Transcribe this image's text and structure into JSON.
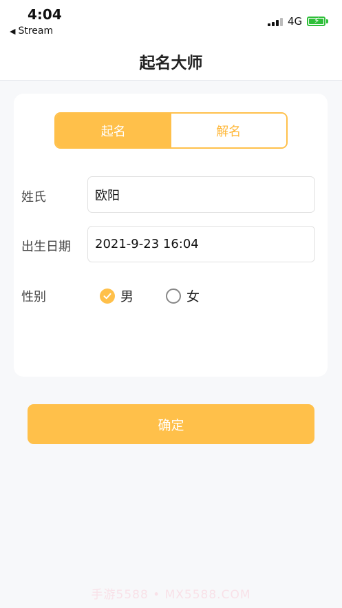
{
  "status_bar": {
    "time": "4:04",
    "back_app": "Stream",
    "network": "4G",
    "battery_charging": true
  },
  "navbar": {
    "title": "起名大师"
  },
  "tabs": [
    {
      "label": "起名",
      "active": true
    },
    {
      "label": "解名",
      "active": false
    }
  ],
  "form": {
    "surname_label": "姓氏",
    "surname_value": "欧阳",
    "birth_label": "出生日期",
    "birth_value": "2021-9-23 16:04",
    "gender_label": "性别",
    "gender_options": [
      {
        "label": "男",
        "selected": true
      },
      {
        "label": "女",
        "selected": false
      }
    ]
  },
  "confirm_label": "确定",
  "watermark": "手游5588 • MX5588.COM",
  "colors": {
    "accent": "#ffc04a",
    "accent_text": "#ffb83a",
    "background": "#f7f8fa"
  }
}
